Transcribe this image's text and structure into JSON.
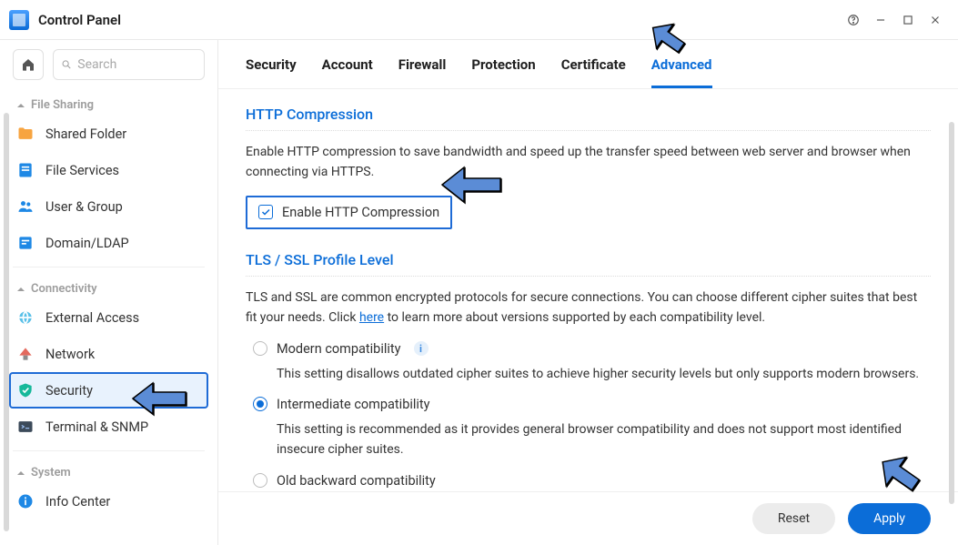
{
  "window": {
    "title": "Control Panel"
  },
  "search": {
    "placeholder": "Search"
  },
  "sidebar": {
    "groups": [
      {
        "label": "File Sharing"
      },
      {
        "label": "Connectivity"
      },
      {
        "label": "System"
      }
    ],
    "items": {
      "shared_folder": "Shared Folder",
      "file_services": "File Services",
      "user_group": "User & Group",
      "domain_ldap": "Domain/LDAP",
      "external_access": "External Access",
      "network": "Network",
      "security": "Security",
      "terminal_snmp": "Terminal & SNMP",
      "info_center": "Info Center"
    }
  },
  "tabs": {
    "security": "Security",
    "account": "Account",
    "firewall": "Firewall",
    "protection": "Protection",
    "certificate": "Certificate",
    "advanced": "Advanced"
  },
  "sections": {
    "http_compression": {
      "title": "HTTP Compression",
      "desc": "Enable HTTP compression to save bandwidth and speed up the transfer speed between web server and browser when connecting via HTTPS.",
      "checkbox_label": "Enable HTTP Compression",
      "checked": true
    },
    "tls": {
      "title": "TLS / SSL Profile Level",
      "desc_pre": "TLS and SSL are common encrypted protocols for secure connections. You can choose different cipher suites that best fit your needs. Click ",
      "desc_link": "here",
      "desc_post": " to learn more about versions supported by each compatibility level.",
      "options": [
        {
          "label": "Modern compatibility",
          "info": true,
          "desc": "This setting disallows outdated cipher suites to achieve higher security levels but only supports modern browsers.",
          "selected": false
        },
        {
          "label": "Intermediate compatibility",
          "info": false,
          "desc": "This setting is recommended as it provides general browser compatibility and does not support most identified insecure cipher suites.",
          "selected": true
        },
        {
          "label": "Old backward compatibility",
          "info": false,
          "desc": "",
          "selected": false
        }
      ]
    }
  },
  "footer": {
    "reset": "Reset",
    "apply": "Apply"
  }
}
